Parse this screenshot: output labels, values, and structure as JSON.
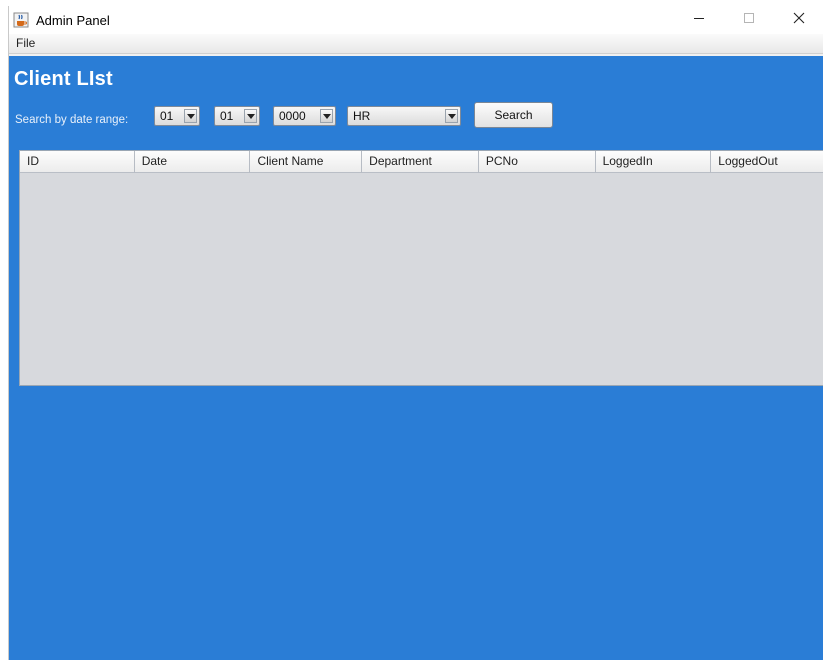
{
  "window": {
    "title": "Admin Panel"
  },
  "menubar": {
    "items": [
      {
        "label": "File"
      }
    ]
  },
  "page": {
    "title": "Client LIst"
  },
  "filters": {
    "label": "Search by date range:",
    "day": "01",
    "month": "01",
    "year": "0000",
    "department": "HR",
    "search_label": "Search"
  },
  "table": {
    "columns": [
      "ID",
      "Date",
      "Client Name",
      "Department",
      "PCNo",
      "LoggedIn",
      "LoggedOut"
    ],
    "rows": []
  },
  "colors": {
    "content_bg": "#2a7dd6",
    "table_bg": "#d7d9dd"
  },
  "icons": {
    "app": "java-cup-icon",
    "minimize": "minimize-icon",
    "maximize": "maximize-icon",
    "close": "close-icon"
  }
}
